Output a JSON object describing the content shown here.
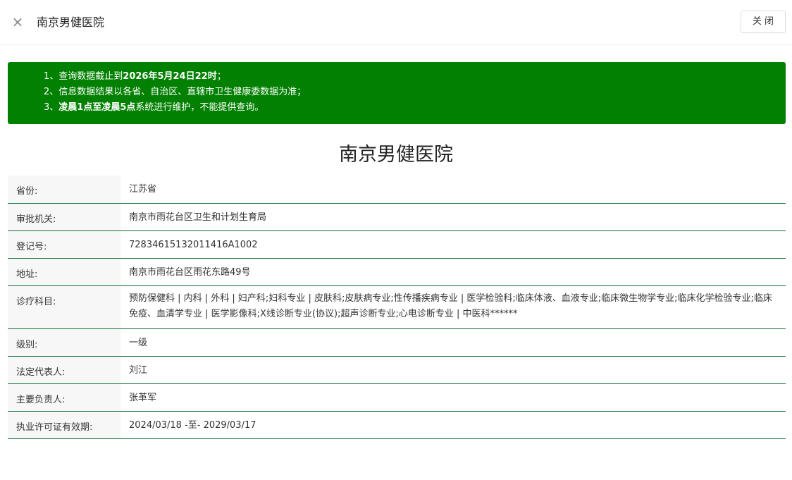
{
  "header": {
    "title": "南京男健医院",
    "close_label": "关 闭",
    "close_icon": "×"
  },
  "notice": {
    "line1_prefix": "1、查询数据截止到",
    "line1_bold": "2026年5月24日22时",
    "line1_suffix": "；",
    "line2": "2、信息数据结果以各省、自治区、直辖市卫生健康委数据为准；",
    "line3_prefix": "3、",
    "line3_bold": "凌晨1点至凌晨5点",
    "line3_suffix": "系统进行维护，不能提供查询。",
    "bg_color": "#018001"
  },
  "main": {
    "title": "南京男健医院",
    "rows": [
      {
        "label": "省份:",
        "value": "江苏省"
      },
      {
        "label": "审批机关:",
        "value": "南京市雨花台区卫生和计划生育局"
      },
      {
        "label": "登记号:",
        "value": "72834615132011416A1002"
      },
      {
        "label": "地址:",
        "value": "南京市雨花台区雨花东路49号"
      },
      {
        "label": "诊疗科目:",
        "value": "预防保健科 | 内科 | 外科 | 妇产科;妇科专业 | 皮肤科;皮肤病专业;性传播疾病专业 | 医学检验科;临床体液、血液专业;临床微生物学专业;临床化学检验专业;临床免疫、血清学专业 | 医学影像科;X线诊断专业(协议);超声诊断专业;心电诊断专业 | 中医科******"
      },
      {
        "label": "级别:",
        "value": "一级"
      },
      {
        "label": "法定代表人:",
        "value": "刘江"
      },
      {
        "label": "主要负责人:",
        "value": "张革军"
      },
      {
        "label": "执业许可证有效期:",
        "value": "2024/03/18 -至- 2029/03/17"
      }
    ]
  }
}
